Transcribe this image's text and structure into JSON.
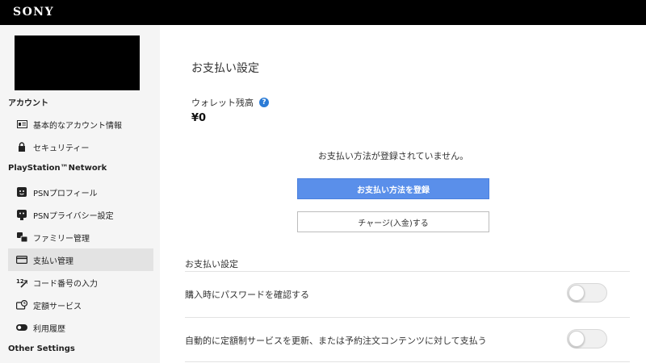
{
  "header": {
    "logo": "SONY"
  },
  "sidebar": {
    "sections": [
      {
        "heading": "アカウント",
        "items": [
          {
            "label": "基本的なアカウント情報",
            "icon": "id-card-icon"
          },
          {
            "label": "セキュリティー",
            "icon": "lock-icon"
          }
        ]
      },
      {
        "heading": "PlayStation™Network",
        "items": [
          {
            "label": "PSNプロフィール",
            "icon": "profile-face-icon"
          },
          {
            "label": "PSNプライバシー設定",
            "icon": "privacy-icon"
          },
          {
            "label": "ファミリー管理",
            "icon": "family-icon"
          },
          {
            "label": "支払い管理",
            "icon": "credit-card-icon",
            "active": true
          },
          {
            "label": "コード番号の入力",
            "icon": "code-entry-icon"
          },
          {
            "label": "定額サービス",
            "icon": "subscription-icon"
          },
          {
            "label": "利用履歴",
            "icon": "history-icon"
          }
        ]
      },
      {
        "heading": "Other Settings"
      }
    ]
  },
  "main": {
    "title": "お支払い設定",
    "wallet": {
      "label": "ウォレット残高",
      "help": "?",
      "value": "¥0"
    },
    "no_method_message": "お支払い方法が登録されていません。",
    "register_button": "お支払い方法を登録",
    "charge_button": "チャージ(入金)する",
    "settings": {
      "heading": "お支払い設定",
      "items": [
        {
          "label": "購入時にパスワードを確認する",
          "enabled": false
        },
        {
          "label": "自動的に定額制サービスを更新、または予約注文コンテンツに対して支払う",
          "enabled": false
        }
      ]
    }
  },
  "colors": {
    "topbar": "#000000",
    "sidebar_bg": "#f5f5f5",
    "active_item_bg": "#e3e3e3",
    "primary_button": "#5a8fea",
    "help_icon": "#2b7bd6"
  }
}
